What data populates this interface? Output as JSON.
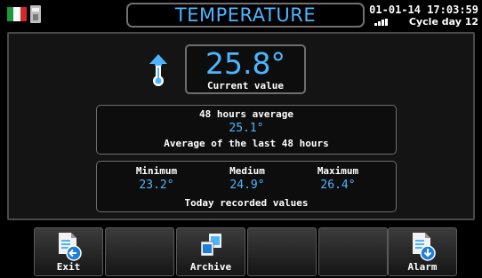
{
  "header": {
    "title": "TEMPERATURE",
    "date_time": "01-01-14 17:03:59",
    "cycle_day": "Cycle day 12",
    "flag_colors": [
      "#1a9a3b",
      "#ffffff",
      "#d62828"
    ]
  },
  "current": {
    "value": "25.8°",
    "label": "Current value",
    "icon": "thermometer-up-icon"
  },
  "average": {
    "title": "48 hours average",
    "value": "25.1°",
    "description": "Average of the last 48 hours"
  },
  "today": {
    "minimum_label": "Minimum",
    "minimum_value": "23.2°",
    "medium_label": "Medium",
    "medium_value": "24.9°",
    "maximum_label": "Maximum",
    "maximum_value": "26.4°",
    "caption": "Today recorded values"
  },
  "buttons": [
    {
      "label": "Exit",
      "icon": "exit-document-icon"
    },
    {
      "label": "",
      "icon": ""
    },
    {
      "label": "Archive",
      "icon": "archive-icon"
    },
    {
      "label": "",
      "icon": ""
    },
    {
      "label": "",
      "icon": ""
    },
    {
      "label": "Alarm",
      "icon": "alarm-document-icon"
    }
  ],
  "colors": {
    "accent": "#4db5ff",
    "background": "#000000",
    "panel": "#141414"
  }
}
